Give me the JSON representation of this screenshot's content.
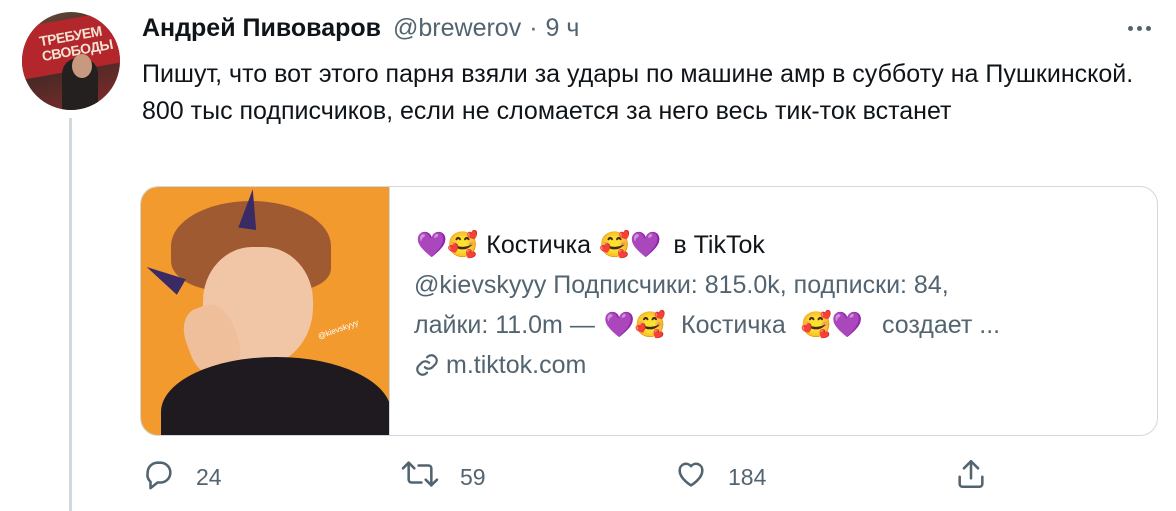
{
  "tweet": {
    "author_name": "Андрей Пивоваров",
    "author_handle": "@brewerov",
    "separator": "·",
    "time": "9 ч",
    "avatar_banner_text": "ТРЕБУЕМ СВОБОДЫ",
    "text": "Пишут, что вот этого парня взяли за удары по машине амр в субботу на Пушкинской. 800 тыс подписчиков, если не сломается за него весь тик-ток встанет"
  },
  "card": {
    "title_prefix_emoji": "💜🥰",
    "title_name": "Костичка",
    "title_suffix_emoji": "🥰💜",
    "title_platform": "в TikTok",
    "description_line1": "@kievskyyy Подписчики: 815.0k, подписки: 84,",
    "description_line2_start": "лайки: 11.0m —",
    "description_line2_emoji1": "💜🥰",
    "description_line2_name": "Костичка",
    "description_line2_emoji2": "🥰💜",
    "description_line2_end": "создает ...",
    "link_domain": "m.tiktok.com",
    "thumb_watermark": "@kievskyyy"
  },
  "actions": {
    "reply_count": "24",
    "retweet_count": "59",
    "like_count": "184"
  },
  "colors": {
    "text_primary": "#0f1419",
    "text_secondary": "#536471",
    "border": "#cfd9de",
    "thumb_background": "#f39a2e"
  }
}
